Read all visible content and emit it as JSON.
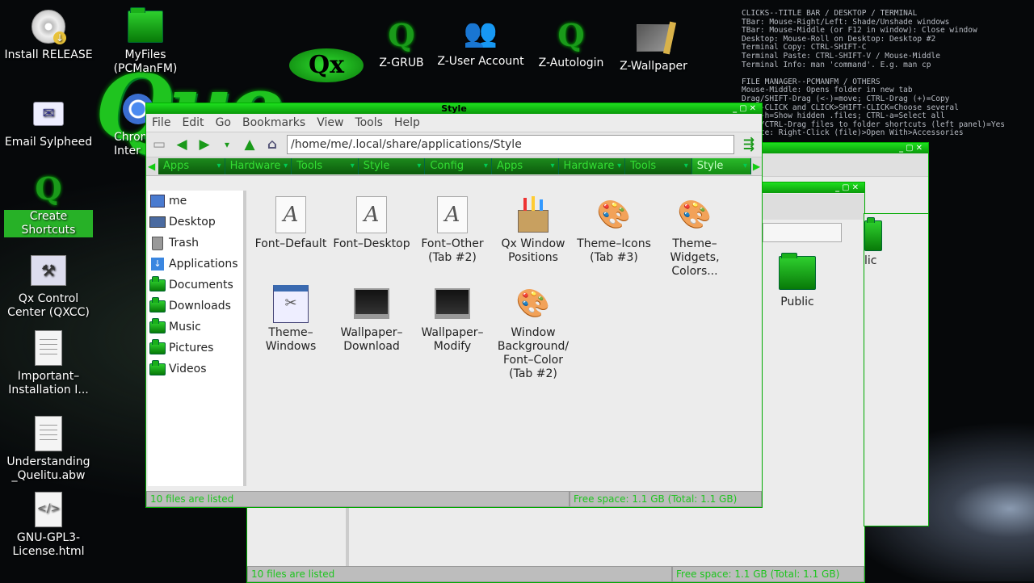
{
  "desktop_icons": [
    {
      "label": "Install RELEASE",
      "icon": "cd-install-icon"
    },
    {
      "label": "MyFiles (PCManFM)",
      "icon": "folder-icon"
    },
    {
      "label": "Email Sylpheed",
      "icon": "email-icon"
    },
    {
      "label": "Chrom Inter",
      "icon": "chromium-icon"
    },
    {
      "label": "Create Shortcuts",
      "icon": "q-shortcut-icon"
    },
    {
      "label": "Qx Control Center (QXCC)",
      "icon": "control-center-icon"
    },
    {
      "label": "Important–Installation I...",
      "icon": "document-icon"
    },
    {
      "label": "Understanding _Quelitu.abw",
      "icon": "document-icon"
    },
    {
      "label": "GNU-GPL3-License.html",
      "icon": "html-icon"
    },
    {
      "label": "Z-GRUB",
      "icon": "q-grub-icon"
    },
    {
      "label": "Z-User Account",
      "icon": "users-icon"
    },
    {
      "label": "Z-Autologin",
      "icon": "q-autologin-icon"
    },
    {
      "label": "Z-Wallpaper",
      "icon": "wallpaper-icon"
    }
  ],
  "logo": {
    "qx": "Qx",
    "que": "Que"
  },
  "hotkeys": "CLICKS--TITLE BAR / DESKTOP / TERMINAL\nTBar: Mouse-Right/Left: Shade/Unshade windows\nTBar: Mouse-Middle (or F12 in window): Close window\nDesktop: Mouse-Roll on Desktop: Desktop #2\nTerminal Copy: CTRL-SHIFT-C\nTerminal Paste: CTRL-SHIFT-V / Mouse-Middle\nTerminal Info: man 'command'. E.g. man cp\n\nFILE MANAGER--PCMANFM / OTHERS\nMouse-Middle: Opens folder in new tab\nDrag/SHIFT-Drag (<-)=move; CTRL-Drag (+)=Copy\nCTRL-CLICK and CLICK>SHIFT-CLICK=Choose several\nCTRL-h=Show hidden .files; CTRL-a=Select all\nDrag/CTRL-Drag files to folder shortcuts (left panel)=Yes\nDelete: Right-Click (file)>Open With>Accessories\n",
  "main_window": {
    "title": "Style",
    "menu": [
      "File",
      "Edit",
      "Go",
      "Bookmarks",
      "View",
      "Tools",
      "Help"
    ],
    "path": "/home/me/.local/share/applications/Style",
    "tabs": [
      "Apps",
      "Hardware",
      "Tools",
      "Style",
      "Config",
      "Apps",
      "Hardware",
      "Tools",
      "Style"
    ],
    "sidebar": [
      {
        "label": "me",
        "icon": "home-icon"
      },
      {
        "label": "Desktop",
        "icon": "desktop-icon"
      },
      {
        "label": "Trash",
        "icon": "trash-icon"
      },
      {
        "label": "Applications",
        "icon": "applications-icon"
      },
      {
        "label": "Documents",
        "icon": "folder-icon"
      },
      {
        "label": "Downloads",
        "icon": "folder-icon"
      },
      {
        "label": "Music",
        "icon": "folder-icon"
      },
      {
        "label": "Pictures",
        "icon": "folder-icon"
      },
      {
        "label": "Videos",
        "icon": "folder-icon"
      }
    ],
    "files": [
      {
        "label": "Font–Default",
        "icon": "font-icon"
      },
      {
        "label": "Font–Desktop",
        "icon": "font-icon"
      },
      {
        "label": "Font–Other (Tab #2)",
        "icon": "font-icon"
      },
      {
        "label": "Qx Window Positions",
        "icon": "window-positions-icon"
      },
      {
        "label": "Theme–Icons (Tab #3)",
        "icon": "theme-palette-icon"
      },
      {
        "label": "Theme–Widgets, Colors...",
        "icon": "theme-palette-icon"
      },
      {
        "label": "Theme–Windows",
        "icon": "window-theme-icon"
      },
      {
        "label": "Wallpaper–Download",
        "icon": "monitor-icon"
      },
      {
        "label": "Wallpaper–Modify",
        "icon": "monitor-icon"
      },
      {
        "label": "Window Background/ Font–Color (Tab #2)",
        "icon": "theme-palette-icon"
      }
    ],
    "status_left": "10 files are listed",
    "status_right": "Free space: 1.1 GB (Total: 1.1 GB)"
  },
  "bg_window": {
    "items": [
      "lic",
      "Public"
    ],
    "status_left": "10 files are listed",
    "status_right": "Free space: 1.1 GB (Total: 1.1 GB)"
  },
  "colors": {
    "accent": "#1ec41e",
    "tab_bg": "#0b5a0b"
  }
}
